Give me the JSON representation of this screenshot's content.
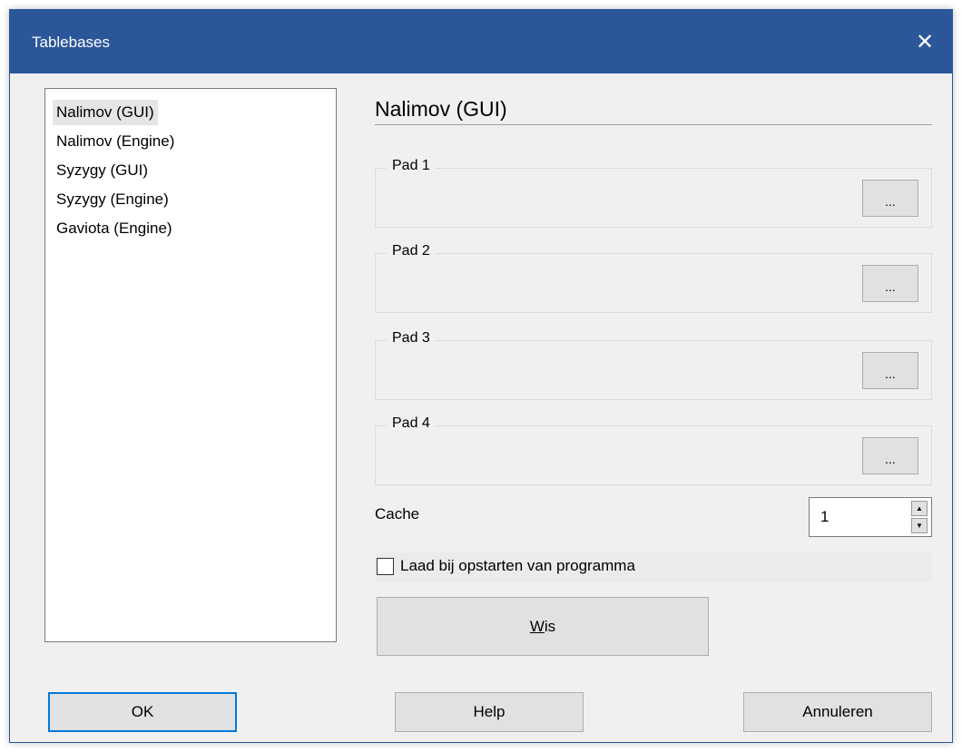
{
  "window": {
    "title": "Tablebases",
    "close_symbol": "✕"
  },
  "list": {
    "items": [
      {
        "label": "Nalimov (GUI)",
        "selected": true
      },
      {
        "label": "Nalimov (Engine)",
        "selected": false
      },
      {
        "label": "Syzygy (GUI)",
        "selected": false
      },
      {
        "label": "Syzygy (Engine)",
        "selected": false
      },
      {
        "label": "Gaviota (Engine)",
        "selected": false
      }
    ]
  },
  "panel": {
    "title": "Nalimov (GUI)",
    "paths": [
      {
        "label": "Pad 1",
        "browse_label": "..."
      },
      {
        "label": "Pad 2",
        "browse_label": "..."
      },
      {
        "label": "Pad 3",
        "browse_label": "..."
      },
      {
        "label": "Pad 4",
        "browse_label": "..."
      }
    ],
    "cache": {
      "label": "Cache",
      "value": "1"
    },
    "load_on_startup": {
      "label": "Laad bij opstarten van programma",
      "checked": false
    },
    "clear_button": {
      "accel": "W",
      "rest": "is"
    }
  },
  "footer": {
    "ok_label": "OK",
    "help_label": "Help",
    "cancel_label": "Annuleren"
  },
  "colors": {
    "titlebar": "#2b579a",
    "dialog_bg": "#f0f0f0",
    "focus_border": "#0078d7"
  }
}
